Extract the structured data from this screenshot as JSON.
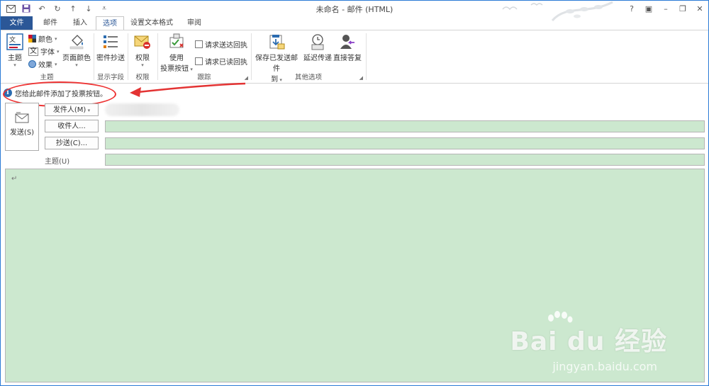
{
  "window": {
    "title": "未命名 - 邮件 (HTML)"
  },
  "qat": [
    {
      "icon": "outlook-icon"
    },
    {
      "icon": "save-icon"
    },
    {
      "icon": "undo-icon"
    },
    {
      "icon": "redo-icon"
    },
    {
      "icon": "up-arrow-icon"
    },
    {
      "icon": "down-arrow-icon"
    },
    {
      "icon": "customize-icon"
    }
  ],
  "window_controls": [
    "?",
    "▣",
    "–",
    "❐",
    "✕"
  ],
  "tabs": [
    {
      "label": "文件",
      "active": false
    },
    {
      "label": "邮件",
      "active": false
    },
    {
      "label": "插入",
      "active": false
    },
    {
      "label": "选项",
      "active": true
    },
    {
      "label": "设置文本格式",
      "active": false
    },
    {
      "label": "审阅",
      "active": false
    }
  ],
  "ribbon": {
    "theme_group": {
      "label": "主题",
      "theme_btn": "主题",
      "colors": "颜色",
      "fonts": "字体",
      "effects": "效果",
      "page_color": "页面颜色"
    },
    "show_fields_group": {
      "label": "显示字段",
      "bcc": "密件抄送"
    },
    "permission_group": {
      "label": "权限",
      "permission": "权限"
    },
    "tracking_group": {
      "label": "跟踪",
      "voting_line1": "使用",
      "voting_line2": "投票按钮",
      "delivery_receipt": "请求送达回执",
      "read_receipt": "请求已读回执"
    },
    "more_options_group": {
      "label": "其他选项",
      "save_sent_line1": "保存已发送邮件",
      "save_sent_line2": "到",
      "delay_delivery": "延迟传递",
      "direct_replies": "直接答复"
    }
  },
  "infobar": {
    "text": "您给此邮件添加了投票按钮。"
  },
  "compose": {
    "send": "发送(S)",
    "from_btn": "发件人(M)",
    "to_btn": "收件人...",
    "cc_btn": "抄送(C)...",
    "subject_label": "主题(U)",
    "body_mark": "↵"
  },
  "watermark": {
    "brand": "Bai du 经验",
    "url": "jingyan.baidu.com"
  },
  "colors": {
    "file_tab": "#2b5797",
    "field_bg": "#cce8cf",
    "annotation": "#e33333"
  }
}
